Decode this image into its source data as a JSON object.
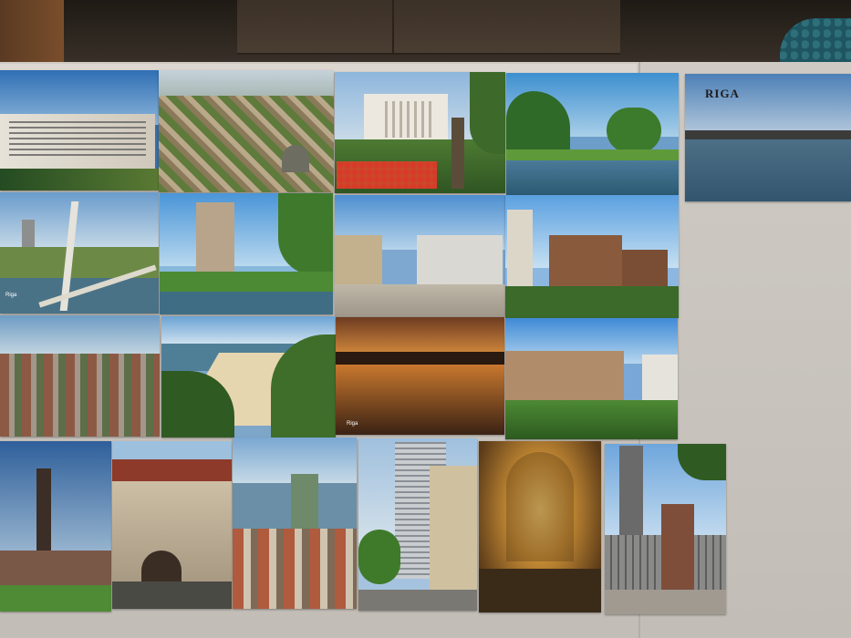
{
  "cover_title": "RIGA",
  "small_captions": {
    "bridge": "Riga",
    "sunset": "Riga"
  }
}
